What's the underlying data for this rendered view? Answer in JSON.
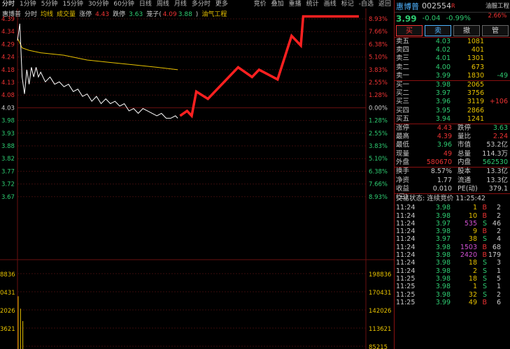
{
  "toolbar": {
    "left": [
      "分时",
      "1分钟",
      "5分钟",
      "15分钟",
      "30分钟",
      "60分钟",
      "日线",
      "周线",
      "月线",
      "多分时",
      "更多"
    ],
    "right": [
      "竞价",
      "叠加",
      "重播",
      "统计",
      "画线",
      "标记",
      "-自选",
      "返回"
    ],
    "active_index": 0
  },
  "legend": {
    "name": "惠博普",
    "items": [
      {
        "text": "分时",
        "color": "#cccccc"
      },
      {
        "text": "均线",
        "color": "#e8c200"
      },
      {
        "text": "成交量",
        "color": "#e8c200"
      },
      {
        "text": "涨停",
        "color": "#cccccc"
      },
      {
        "text": "4.43",
        "color": "#ee3333"
      },
      {
        "text": "跌停",
        "color": "#cccccc"
      },
      {
        "text": "3.63",
        "color": "#2ecc71"
      },
      {
        "text": "笼子(",
        "color": "#cccccc"
      },
      {
        "text": "4.09",
        "color": "#ee3333"
      },
      {
        "text": "3.88",
        "color": "#2ecc71"
      },
      {
        "text": ")",
        "color": "#cccccc"
      },
      {
        "text": "油气工程",
        "color": "#e8c200"
      }
    ]
  },
  "chart_data": {
    "type": "line",
    "y_price_ticks": [
      "4.39",
      "4.34",
      "4.29",
      "4.24",
      "4.18",
      "4.13",
      "4.08",
      "4.03",
      "3.98",
      "3.93",
      "3.88",
      "3.82",
      "3.77",
      "3.72",
      "3.67"
    ],
    "y_pct_ticks": [
      "8.93%",
      "7.66%",
      "6.38%",
      "5.10%",
      "3.83%",
      "2.55%",
      "1.28%",
      "0.00%",
      "1.28%",
      "2.55%",
      "3.83%",
      "5.10%",
      "6.38%",
      "7.66%",
      "8.93%"
    ],
    "prev_close": 4.03,
    "volume_ticks_left": [
      "8836",
      "0431",
      "2026",
      "3621"
    ],
    "volume_ticks_right": [
      "198836",
      "170431",
      "142026",
      "113621",
      "85215"
    ],
    "price_series": {
      "name": "分时",
      "points": [
        [
          0,
          4.3
        ],
        [
          1,
          4.37
        ],
        [
          2,
          4.15
        ],
        [
          3,
          4.08
        ],
        [
          4,
          4.18
        ],
        [
          5,
          4.12
        ],
        [
          6,
          4.19
        ],
        [
          7,
          4.15
        ],
        [
          8,
          4.19
        ],
        [
          9,
          4.15
        ],
        [
          10,
          4.17
        ],
        [
          12,
          4.13
        ],
        [
          14,
          4.15
        ],
        [
          16,
          4.12
        ],
        [
          18,
          4.13
        ],
        [
          20,
          4.11
        ],
        [
          22,
          4.12
        ],
        [
          24,
          4.09
        ],
        [
          26,
          4.1
        ],
        [
          28,
          4.07
        ],
        [
          30,
          4.08
        ],
        [
          32,
          4.05
        ],
        [
          34,
          4.07
        ],
        [
          36,
          4.04
        ],
        [
          38,
          4.06
        ],
        [
          40,
          4.04
        ],
        [
          42,
          4.05
        ],
        [
          44,
          4.03
        ],
        [
          46,
          4.04
        ],
        [
          48,
          4.01
        ],
        [
          50,
          4.02
        ],
        [
          52,
          4.0
        ],
        [
          54,
          4.02
        ],
        [
          56,
          4.01
        ],
        [
          58,
          4.0
        ],
        [
          60,
          3.99
        ],
        [
          62,
          4.0
        ],
        [
          64,
          3.98
        ],
        [
          66,
          3.98
        ],
        [
          68,
          3.99
        ],
        [
          69,
          3.98
        ]
      ]
    },
    "avg_series": {
      "name": "均线",
      "points": [
        [
          0,
          4.31
        ],
        [
          2,
          4.27
        ],
        [
          5,
          4.26
        ],
        [
          10,
          4.25
        ],
        [
          20,
          4.24
        ],
        [
          30,
          4.22
        ],
        [
          40,
          4.21
        ],
        [
          50,
          4.2
        ],
        [
          60,
          4.19
        ],
        [
          69,
          4.18
        ]
      ]
    },
    "projection_series": {
      "points": [
        [
          70,
          3.99
        ],
        [
          73,
          4.01
        ],
        [
          75,
          3.99
        ],
        [
          77,
          4.09
        ],
        [
          82,
          4.06
        ],
        [
          95,
          4.19
        ],
        [
          101,
          4.15
        ],
        [
          104,
          4.18
        ],
        [
          112,
          4.14
        ],
        [
          118,
          4.32
        ],
        [
          122,
          4.28
        ],
        [
          123,
          4.4
        ],
        [
          147,
          4.4
        ]
      ]
    },
    "volume_bars": [
      [
        0,
        170000
      ],
      [
        1,
        140000
      ],
      [
        2,
        110000
      ]
    ],
    "volume_range": [
      85215,
      198836
    ],
    "x_range": [
      0,
      150
    ],
    "y_range": [
      3.65,
      4.41
    ]
  },
  "quote": {
    "name": "惠博普",
    "code": "002554",
    "r_badge": "R",
    "sector_tag": "油服工程",
    "sector_change": "2.66%",
    "price": "3.99",
    "change": "-0.04",
    "change_pct": "-0.99%",
    "buttons": [
      "买",
      "卖",
      "撤",
      "管"
    ],
    "asks": [
      {
        "label": "卖五",
        "price": "4.03",
        "vol": "1081",
        "chg": ""
      },
      {
        "label": "卖四",
        "price": "4.02",
        "vol": "401",
        "chg": ""
      },
      {
        "label": "卖三",
        "price": "4.01",
        "vol": "1301",
        "chg": ""
      },
      {
        "label": "卖二",
        "price": "4.00",
        "vol": "673",
        "chg": ""
      },
      {
        "label": "卖一",
        "price": "3.99",
        "vol": "1830",
        "chg": "-49"
      }
    ],
    "bids": [
      {
        "label": "买一",
        "price": "3.98",
        "vol": "2065",
        "chg": ""
      },
      {
        "label": "买二",
        "price": "3.97",
        "vol": "3756",
        "chg": ""
      },
      {
        "label": "买三",
        "price": "3.96",
        "vol": "3119",
        "chg": "+106"
      },
      {
        "label": "买四",
        "price": "3.95",
        "vol": "2866",
        "chg": ""
      },
      {
        "label": "买五",
        "price": "3.94",
        "vol": "1241",
        "chg": ""
      }
    ],
    "stats": [
      {
        "k1": "涨停",
        "v1": "4.43",
        "c1": "red",
        "k2": "跌停",
        "v2": "3.63",
        "c2": "green"
      },
      {
        "k1": "最高",
        "v1": "4.39",
        "c1": "red",
        "k2": "量比",
        "v2": "2.24",
        "c2": "red"
      },
      {
        "k1": "最低",
        "v1": "3.96",
        "c1": "green",
        "k2": "市值",
        "v2": "53.2亿",
        "c2": "white"
      },
      {
        "k1": "现量",
        "v1": "49",
        "c1": "red",
        "k2": "总量",
        "v2": "114.3万",
        "c2": "white"
      },
      {
        "k1": "外盘",
        "v1": "580670",
        "c1": "red",
        "k2": "内盘",
        "v2": "562530",
        "c2": "green"
      }
    ],
    "stats2": [
      {
        "k1": "换手",
        "v1": "8.57%",
        "c1": "white",
        "k2": "股本",
        "v2": "13.3亿",
        "c2": "white"
      },
      {
        "k1": "净资",
        "v1": "1.77",
        "c1": "white",
        "k2": "流通",
        "v2": "13.3亿",
        "c2": "white"
      },
      {
        "k1": "收益(三)",
        "v1": "0.010",
        "c1": "white",
        "k2": "PE(动)",
        "v2": "379.1",
        "c2": "white"
      }
    ],
    "trade_state": "交易状态: 连续竞价 11:25:42",
    "ticks": [
      {
        "t": "11:24",
        "p": "3.98",
        "pc": "green",
        "v": "1",
        "vc": "yel",
        "bs": "B",
        "bsc": "red",
        "n": "2"
      },
      {
        "t": "11:24",
        "p": "3.98",
        "pc": "green",
        "v": "10",
        "vc": "yel",
        "bs": "B",
        "bsc": "red",
        "n": "2"
      },
      {
        "t": "11:24",
        "p": "3.97",
        "pc": "green",
        "v": "535",
        "vc": "mag",
        "bs": "S",
        "bsc": "green",
        "n": "46"
      },
      {
        "t": "11:24",
        "p": "3.98",
        "pc": "green",
        "v": "9",
        "vc": "yel",
        "bs": "B",
        "bsc": "red",
        "n": "2"
      },
      {
        "t": "11:24",
        "p": "3.97",
        "pc": "green",
        "v": "38",
        "vc": "yel",
        "bs": "S",
        "bsc": "green",
        "n": "4"
      },
      {
        "t": "11:24",
        "p": "3.98",
        "pc": "green",
        "v": "1503",
        "vc": "mag",
        "bs": "B",
        "bsc": "red",
        "n": "68"
      },
      {
        "t": "11:24",
        "p": "3.98",
        "pc": "green",
        "v": "2420",
        "vc": "mag",
        "bs": "B",
        "bsc": "red",
        "n": "179"
      },
      {
        "t": "11:24",
        "p": "3.98",
        "pc": "green",
        "v": "18",
        "vc": "yel",
        "bs": "S",
        "bsc": "green",
        "n": "3"
      },
      {
        "t": "11:24",
        "p": "3.98",
        "pc": "green",
        "v": "2",
        "vc": "yel",
        "bs": "S",
        "bsc": "green",
        "n": "1"
      },
      {
        "t": "11:25",
        "p": "3.98",
        "pc": "green",
        "v": "18",
        "vc": "yel",
        "bs": "S",
        "bsc": "green",
        "n": "5"
      },
      {
        "t": "11:25",
        "p": "3.98",
        "pc": "green",
        "v": "1",
        "vc": "yel",
        "bs": "S",
        "bsc": "green",
        "n": "1"
      },
      {
        "t": "11:25",
        "p": "3.98",
        "pc": "green",
        "v": "32",
        "vc": "yel",
        "bs": "S",
        "bsc": "green",
        "n": "2"
      },
      {
        "t": "11:25",
        "p": "3.99",
        "pc": "green",
        "v": "49",
        "vc": "yel",
        "bs": "B",
        "bsc": "red",
        "n": "6"
      }
    ]
  }
}
